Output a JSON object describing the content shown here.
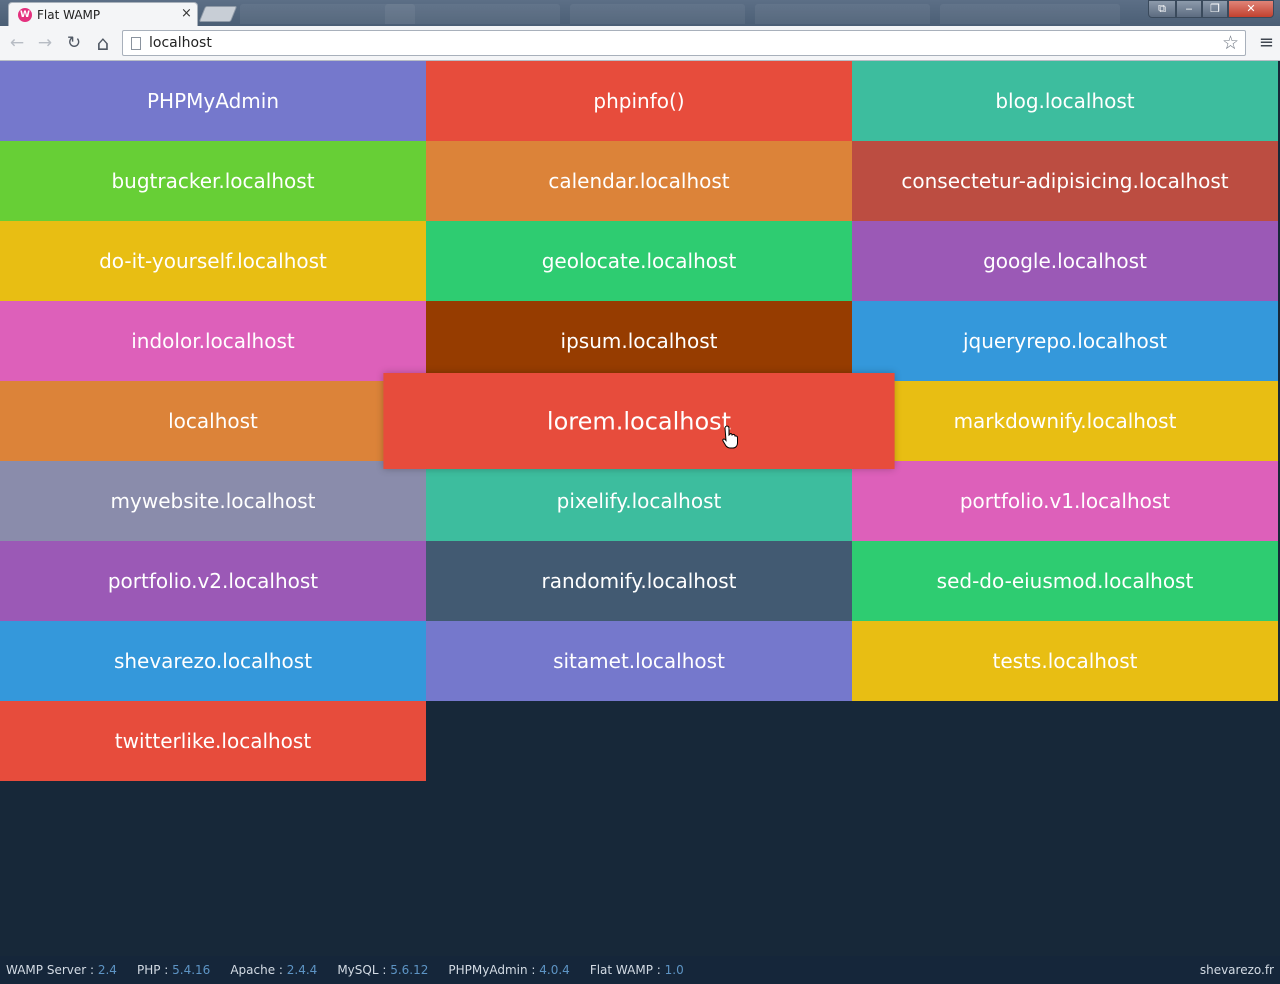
{
  "browser": {
    "tab_title": "Flat WAMP",
    "favicon_letter": "W",
    "tab_close": "×",
    "url": "localhost",
    "window_buttons": {
      "extra": "⧉",
      "minimize": "‒",
      "maximize": "❐",
      "close": "✕"
    }
  },
  "nav": {
    "back": "←",
    "forward": "→",
    "reload": "↻",
    "home": "⌂",
    "star": "☆",
    "menu": "≡"
  },
  "tiles": [
    {
      "label": "PHPMyAdmin",
      "color": "#7578cc"
    },
    {
      "label": "phpinfo()",
      "color": "#e74c3c"
    },
    {
      "label": "blog.localhost",
      "color": "#3dbd9e"
    },
    {
      "label": "bugtracker.localhost",
      "color": "#67cf36"
    },
    {
      "label": "calendar.localhost",
      "color": "#dc8339"
    },
    {
      "label": "consectetur-adipisicing.localhost",
      "color": "#bc4d41"
    },
    {
      "label": "do-it-yourself.localhost",
      "color": "#e8be13"
    },
    {
      "label": "geolocate.localhost",
      "color": "#2ecc71"
    },
    {
      "label": "google.localhost",
      "color": "#9b59b6"
    },
    {
      "label": "indolor.localhost",
      "color": "#dd60ba"
    },
    {
      "label": "ipsum.localhost",
      "color": "#963c00"
    },
    {
      "label": "jqueryrepo.localhost",
      "color": "#3498db"
    },
    {
      "label": "localhost",
      "color": "#dc8339"
    },
    {
      "label": "lorem.localhost",
      "color": "#e74c3c"
    },
    {
      "label": "markdownify.localhost",
      "color": "#e8be13"
    },
    {
      "label": "mywebsite.localhost",
      "color": "#8a8cab"
    },
    {
      "label": "pixelify.localhost",
      "color": "#3dbd9e"
    },
    {
      "label": "portfolio.v1.localhost",
      "color": "#dd60ba"
    },
    {
      "label": "portfolio.v2.localhost",
      "color": "#9b59b6"
    },
    {
      "label": "randomify.localhost",
      "color": "#425a72"
    },
    {
      "label": "sed-do-eiusmod.localhost",
      "color": "#2ecc71"
    },
    {
      "label": "shevarezo.localhost",
      "color": "#3498db"
    },
    {
      "label": "sitamet.localhost",
      "color": "#7578cc"
    },
    {
      "label": "tests.localhost",
      "color": "#e8be13"
    },
    {
      "label": "twitterlike.localhost",
      "color": "#e74c3c"
    }
  ],
  "hovered_tile": "lorem.localhost",
  "footer": {
    "items": [
      {
        "label": "WAMP Server :",
        "value": "2.4"
      },
      {
        "label": "PHP :",
        "value": "5.4.16"
      },
      {
        "label": "Apache :",
        "value": "2.4.4"
      },
      {
        "label": "MySQL :",
        "value": "5.6.12"
      },
      {
        "label": "PHPMyAdmin :",
        "value": "4.0.4"
      },
      {
        "label": "Flat WAMP :",
        "value": "1.0"
      }
    ],
    "credit": "shevarezo.fr"
  }
}
